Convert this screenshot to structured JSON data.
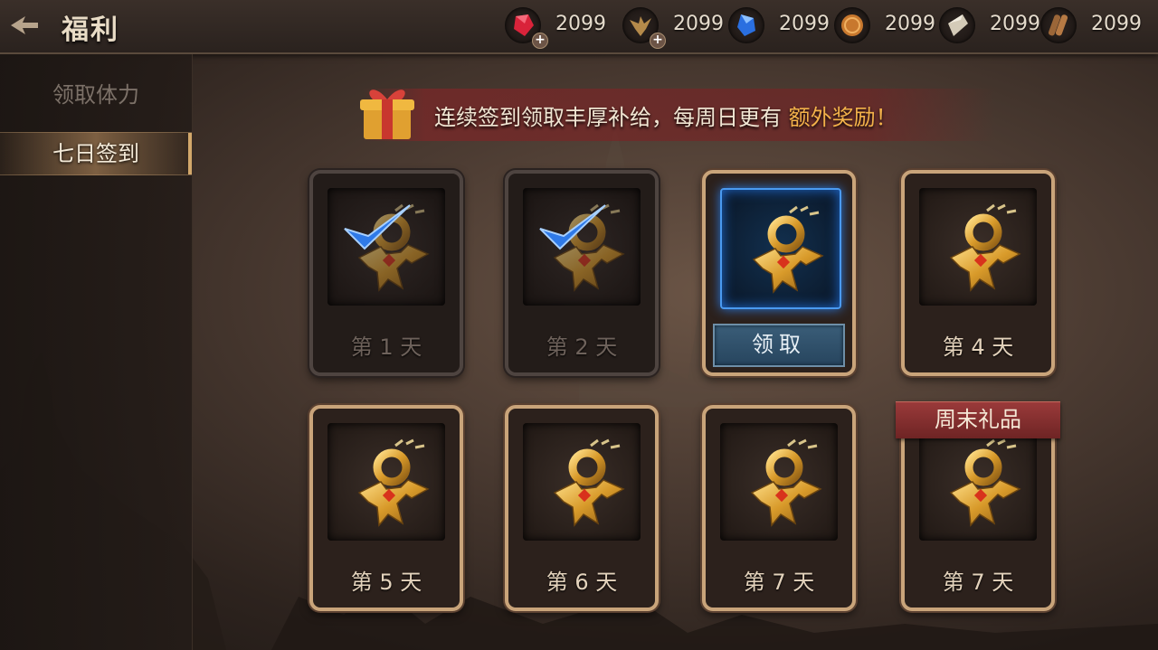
{
  "header": {
    "title": "福利"
  },
  "resources": [
    {
      "icon": "ruby-icon",
      "value": "2099",
      "has_plus": true
    },
    {
      "icon": "eagle-icon",
      "value": "2099",
      "has_plus": true
    },
    {
      "icon": "sapphire-icon",
      "value": "2099",
      "has_plus": false
    },
    {
      "icon": "coin-icon",
      "value": "2099",
      "has_plus": false
    },
    {
      "icon": "stone-icon",
      "value": "2099",
      "has_plus": false
    },
    {
      "icon": "wood-icon",
      "value": "2099",
      "has_plus": false
    }
  ],
  "sidebar": {
    "items": [
      {
        "label": "领取体力",
        "active": false
      },
      {
        "label": "七日签到",
        "active": true
      }
    ]
  },
  "banner": {
    "text": "连续签到领取丰厚补给，每周日更有 ",
    "highlight": "额外奖励！"
  },
  "cards": [
    {
      "label": "第 1 天",
      "state": "claimed"
    },
    {
      "label": "第 2 天",
      "state": "claimed"
    },
    {
      "label": "第 3 天",
      "state": "today",
      "button": "领取"
    },
    {
      "label": "第 4 天",
      "state": "locked"
    },
    {
      "label": "第 5 天",
      "state": "locked"
    },
    {
      "label": "第 6 天",
      "state": "locked"
    },
    {
      "label": "第 7 天",
      "state": "locked"
    },
    {
      "label": "第 7 天",
      "state": "locked",
      "ribbon": "周末礼品"
    }
  ],
  "colors": {
    "accent": "#f3b24a",
    "card_border": "#c9a47a",
    "claim_button": "#3a5d78",
    "ribbon": "#9a3a3a"
  }
}
